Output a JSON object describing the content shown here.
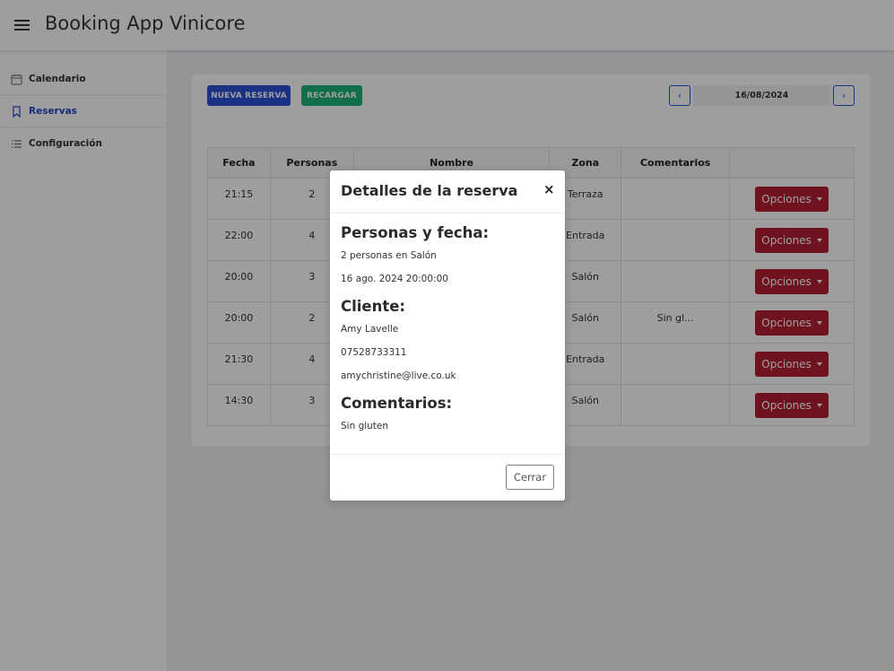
{
  "header": {
    "title": "Booking App Vinicore"
  },
  "sidebar": {
    "items": [
      {
        "label": "Calendario",
        "icon": "calendar-icon",
        "active": false
      },
      {
        "label": "Reservas",
        "icon": "bookmark-icon",
        "active": true
      },
      {
        "label": "Configuración",
        "icon": "list-icon",
        "active": false
      }
    ]
  },
  "toolbar": {
    "new_label": "NUEVA RESERVA",
    "reload_label": "RECARGAR",
    "prev_label": "‹",
    "next_label": "›",
    "date": "16/08/2024"
  },
  "table": {
    "columns": [
      "Fecha",
      "Personas",
      "Nombre",
      "Zona",
      "Comentarios",
      ""
    ],
    "rows": [
      {
        "fecha": "21:15",
        "personas": "2",
        "nombre": "",
        "zona": "Terraza",
        "comentarios": ""
      },
      {
        "fecha": "22:00",
        "personas": "4",
        "nombre": "",
        "zona": "Entrada",
        "comentarios": ""
      },
      {
        "fecha": "20:00",
        "personas": "3",
        "nombre": "",
        "zona": "Salón",
        "comentarios": ""
      },
      {
        "fecha": "20:00",
        "personas": "2",
        "nombre": "",
        "zona": "Salón",
        "comentarios": "Sin gl..."
      },
      {
        "fecha": "21:30",
        "personas": "4",
        "nombre": "",
        "zona": "Entrada",
        "comentarios": ""
      },
      {
        "fecha": "14:30",
        "personas": "3",
        "nombre": "",
        "zona": "Salón",
        "comentarios": ""
      }
    ],
    "options_label": "Opciones"
  },
  "modal": {
    "title": "Detalles de la reserva",
    "close_symbol": "×",
    "section_people": "Personas y fecha:",
    "people_text": "2 personas en Salón",
    "date_text": "16 ago. 2024 20:00:00",
    "section_client": "Cliente:",
    "client_name": "Amy Lavelle",
    "client_phone": "07528733311",
    "client_email": "amychristine@live.co.uk",
    "section_comments": "Comentarios:",
    "comments_text": "Sin gluten",
    "close_button": "Cerrar"
  },
  "colors": {
    "primary": "#2a4fd6",
    "success": "#19b37a",
    "danger": "#b51f33"
  }
}
